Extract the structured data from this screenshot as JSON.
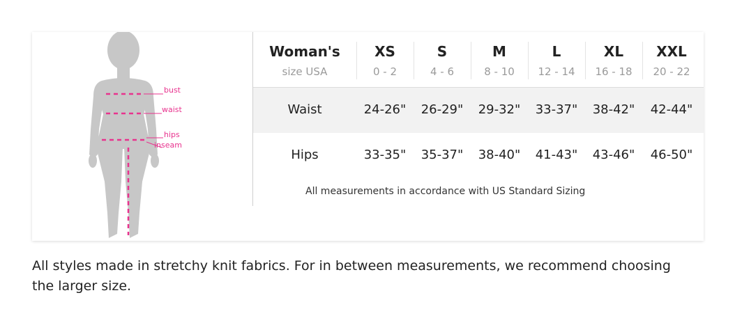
{
  "figure": {
    "labels": {
      "bust": "bust",
      "waist": "waist",
      "hips": "hips",
      "inseam": "inseam"
    },
    "silhouette_color": "#c7c7c7",
    "measure_color": "#e8338e"
  },
  "table": {
    "title": "Woman's",
    "subtitle": "size USA",
    "sizes": [
      {
        "name": "XS",
        "range": "0 - 2"
      },
      {
        "name": "S",
        "range": "4 - 6"
      },
      {
        "name": "M",
        "range": "8 - 10"
      },
      {
        "name": "L",
        "range": "12 - 14"
      },
      {
        "name": "XL",
        "range": "16 - 18"
      },
      {
        "name": "XXL",
        "range": "20 - 22"
      }
    ],
    "rows": [
      {
        "label": "Waist",
        "values": [
          "24-26\"",
          "26-29\"",
          "29-32\"",
          "33-37\"",
          "38-42\"",
          "42-44\""
        ]
      },
      {
        "label": "Hips",
        "values": [
          "33-35\"",
          "35-37\"",
          "38-40\"",
          "41-43\"",
          "43-46\"",
          "46-50\""
        ]
      }
    ],
    "footnote": "All measurements in accordance with US Standard Sizing"
  },
  "note": "All styles made in stretchy knit fabrics. For in between measurements, we recommend choosing the larger size."
}
